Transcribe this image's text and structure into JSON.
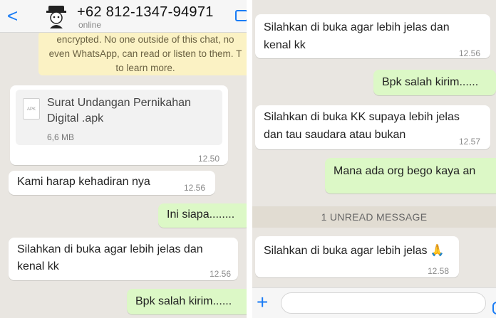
{
  "left": {
    "header": {
      "back_glyph": "<",
      "contact_name": "+62 812-1347-94971",
      "status": "online"
    },
    "notice": {
      "line1": "encrypted. No one outside of this chat, no",
      "line2": "even WhatsApp, can read or listen to them. T",
      "line3": "to learn more."
    },
    "file_message": {
      "icon_label": "APK",
      "file_name": "Surat Undangan Pernikahan Digital .apk",
      "file_size": "6,6 MB",
      "time": "12.50"
    },
    "messages": [
      {
        "text": "Kami harap kehadiran nya",
        "time": "12.56"
      },
      {
        "text": "Ini siapa........"
      },
      {
        "text": "Silahkan di buka agar lebih jelas dan",
        "text2": "kenal kk",
        "time": "12.56"
      },
      {
        "text": "Bpk salah kirim......"
      }
    ]
  },
  "right": {
    "messages": [
      {
        "text": "Silahkan di buka agar lebih jelas dan",
        "text2": "kenal kk",
        "time": "12.56"
      },
      {
        "text": "Bpk salah kirim......"
      },
      {
        "text": "Silahkan di buka KK supaya lebih jelas",
        "text2": "dan tau saudara atau bukan",
        "time": "12.57"
      },
      {
        "text": "Mana ada org bego kaya an"
      },
      {
        "text": "Silahkan di buka agar lebih jelas 🙏",
        "time": "12.58"
      }
    ],
    "unread_label": "1 UNREAD MESSAGE",
    "input_bar": {
      "plus_glyph": "+"
    }
  }
}
